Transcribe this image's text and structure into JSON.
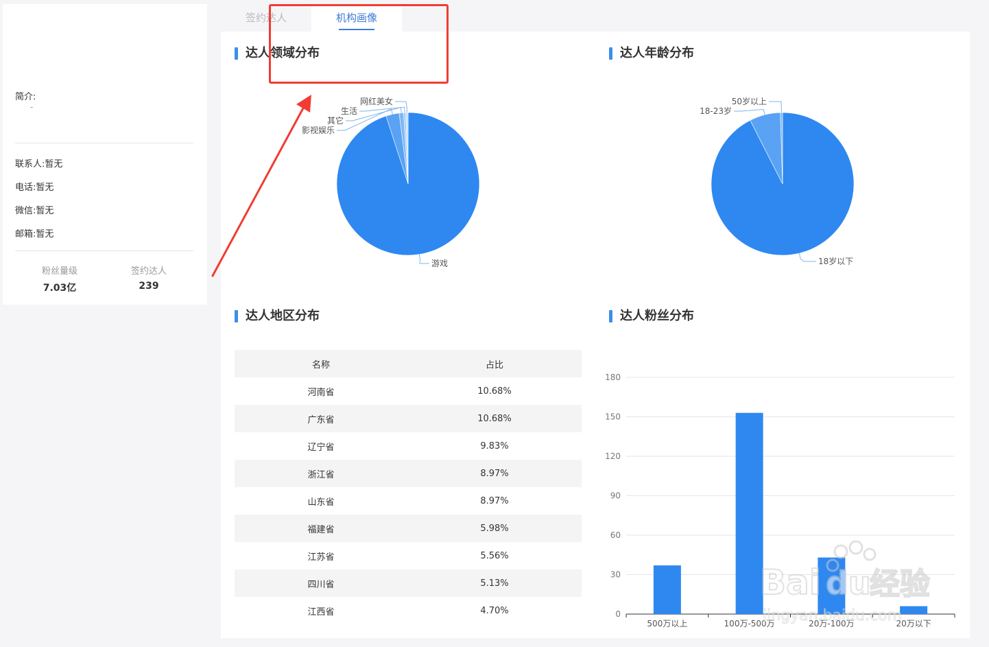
{
  "profile": {
    "intro_label": "简介:",
    "intro_text": "-",
    "contacts": [
      {
        "label": "联系人:",
        "value": "暂无"
      },
      {
        "label": "电话:",
        "value": "暂无"
      },
      {
        "label": "微信:",
        "value": "暂无"
      },
      {
        "label": "邮箱:",
        "value": "暂无"
      }
    ],
    "stats": [
      {
        "label": "粉丝量级",
        "value": "7.03亿"
      },
      {
        "label": "签约达人",
        "value": "239"
      }
    ]
  },
  "tabs": [
    {
      "label": "签约达人",
      "active": false
    },
    {
      "label": "机构画像",
      "active": true
    }
  ],
  "sections": {
    "domain_title": "达人领域分布",
    "age_title": "达人年龄分布",
    "region_title": "达人地区分布",
    "fans_title": "达人粉丝分布"
  },
  "colors": {
    "accent": "#3d7bd6",
    "pie_main": "#2e88f0",
    "bar": "#2e88f0",
    "highlight": "#f03c32"
  },
  "region_table": {
    "headers": [
      "名称",
      "占比"
    ],
    "rows": [
      [
        "河南省",
        "10.68%"
      ],
      [
        "广东省",
        "10.68%"
      ],
      [
        "辽宁省",
        "9.83%"
      ],
      [
        "浙江省",
        "8.97%"
      ],
      [
        "山东省",
        "8.97%"
      ],
      [
        "福建省",
        "5.98%"
      ],
      [
        "江苏省",
        "5.56%"
      ],
      [
        "四川省",
        "5.13%"
      ],
      [
        "江西省",
        "4.70%"
      ]
    ]
  },
  "chart_data": [
    {
      "type": "pie",
      "title": "达人领域分布",
      "slices": [
        {
          "name": "游戏",
          "value": 95.0
        },
        {
          "name": "影视娱乐",
          "value": 3.0
        },
        {
          "name": "其它",
          "value": 1.0
        },
        {
          "name": "生活",
          "value": 0.5
        },
        {
          "name": "网红美女",
          "value": 0.5
        }
      ]
    },
    {
      "type": "pie",
      "title": "达人年龄分布",
      "slices": [
        {
          "name": "18岁以下",
          "value": 92.5
        },
        {
          "name": "18-23岁",
          "value": 7.0
        },
        {
          "name": "50岁以上",
          "value": 0.5
        }
      ]
    },
    {
      "type": "bar",
      "title": "达人粉丝分布",
      "categories": [
        "500万以上",
        "100万-500万",
        "20万-100万",
        "20万以下"
      ],
      "values": [
        37,
        153,
        43,
        6
      ],
      "ylim": [
        0,
        180
      ],
      "yticks": [
        0,
        30,
        60,
        90,
        120,
        150,
        180
      ],
      "grid": true
    }
  ],
  "watermark": {
    "brand": "Bai",
    "paw": "du",
    "cn": "经验",
    "url": "jingyan.baidu.com"
  }
}
